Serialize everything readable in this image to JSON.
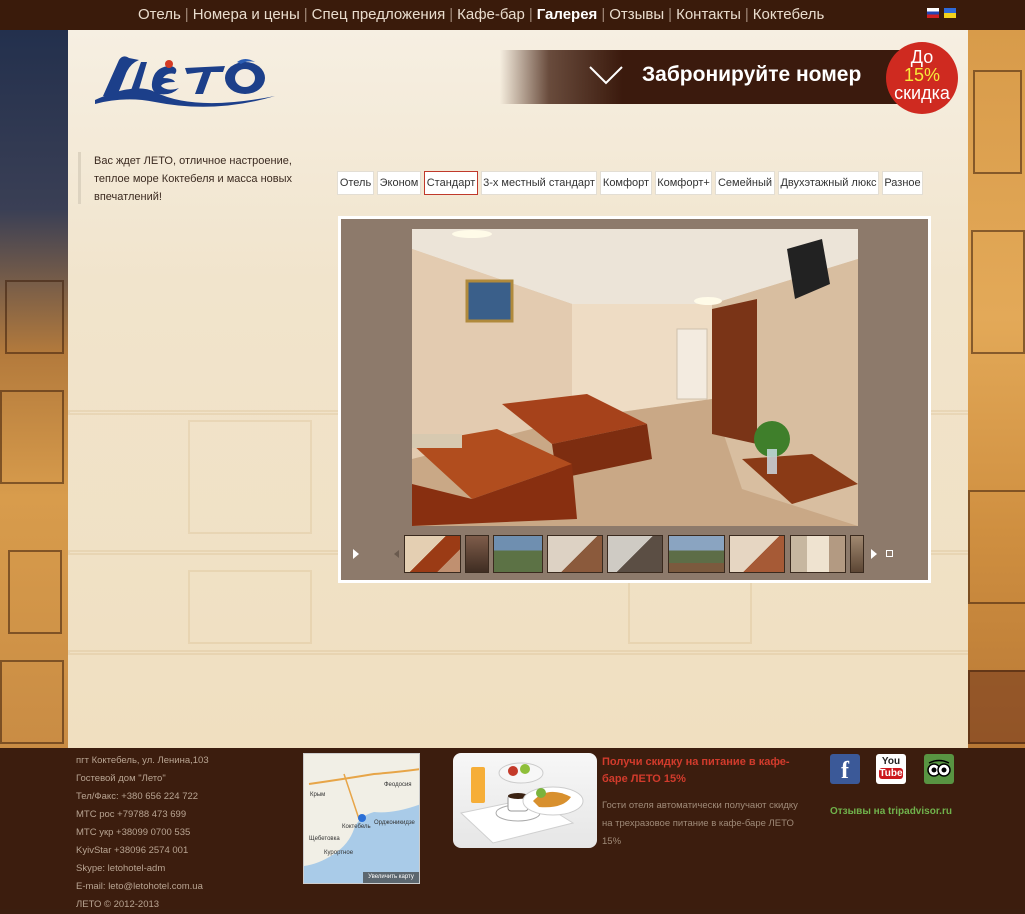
{
  "nav": {
    "items": [
      "Отель",
      "Номера и цены",
      "Спец предложения",
      "Кафе-бар",
      "Галерея",
      "Отзывы",
      "Контакты",
      "Коктебель"
    ],
    "active": "Галерея"
  },
  "booking": {
    "text": "Забронируйте номер"
  },
  "discount": {
    "line1": "До",
    "pct": "15%",
    "line3": "скидка"
  },
  "intro": {
    "text": "Вас ждет ЛЕТО, отличное настроение, теплое море Коктебеля и масса новых впечатлений!"
  },
  "gallery": {
    "tabs": [
      "Отель",
      "Эконом",
      "Стандарт",
      "3-х местный стандарт",
      "Комфорт",
      "Комфорт+",
      "Семейный",
      "Двухэтажный люкс",
      "Разное"
    ],
    "active_tab": "Стандарт"
  },
  "footer": {
    "address": [
      "пгт Коктебель, ул. Ленина,103",
      "Гостевой дом \"Лето\"",
      "Тел/Факс: +380 656 224 722",
      "МТС рос +79788 473 699",
      "МТС укр +38099 0700 535",
      "KyivStar +38096 2574 001",
      "Skype: letohotel-adm",
      "E-mail: leto@letohotel.com.ua",
      "ЛЕТО © 2012-2013"
    ],
    "map_button": "Увеличить карту",
    "map_labels": [
      "Крым",
      "Феодосия",
      "Орджоникидзе",
      "Коктебель",
      "Щебетовка",
      "Курортное"
    ],
    "promo_title": "Получи скидку на питание в кафе-баре ЛЕТО 15%",
    "promo_body": "Гости отеля автоматически получают скидку на трехразовое питание в кафе-баре ЛЕТО 15%",
    "trip_link": "Отзывы на tripadvisor.ru",
    "yt_label_top": "You",
    "yt_label_bottom": "Tube"
  },
  "colors": {
    "accent_red": "#cf2a20",
    "nav_bg": "#3a1b0b",
    "promo_red": "#d23b2c",
    "trip_green": "#70b24c"
  }
}
